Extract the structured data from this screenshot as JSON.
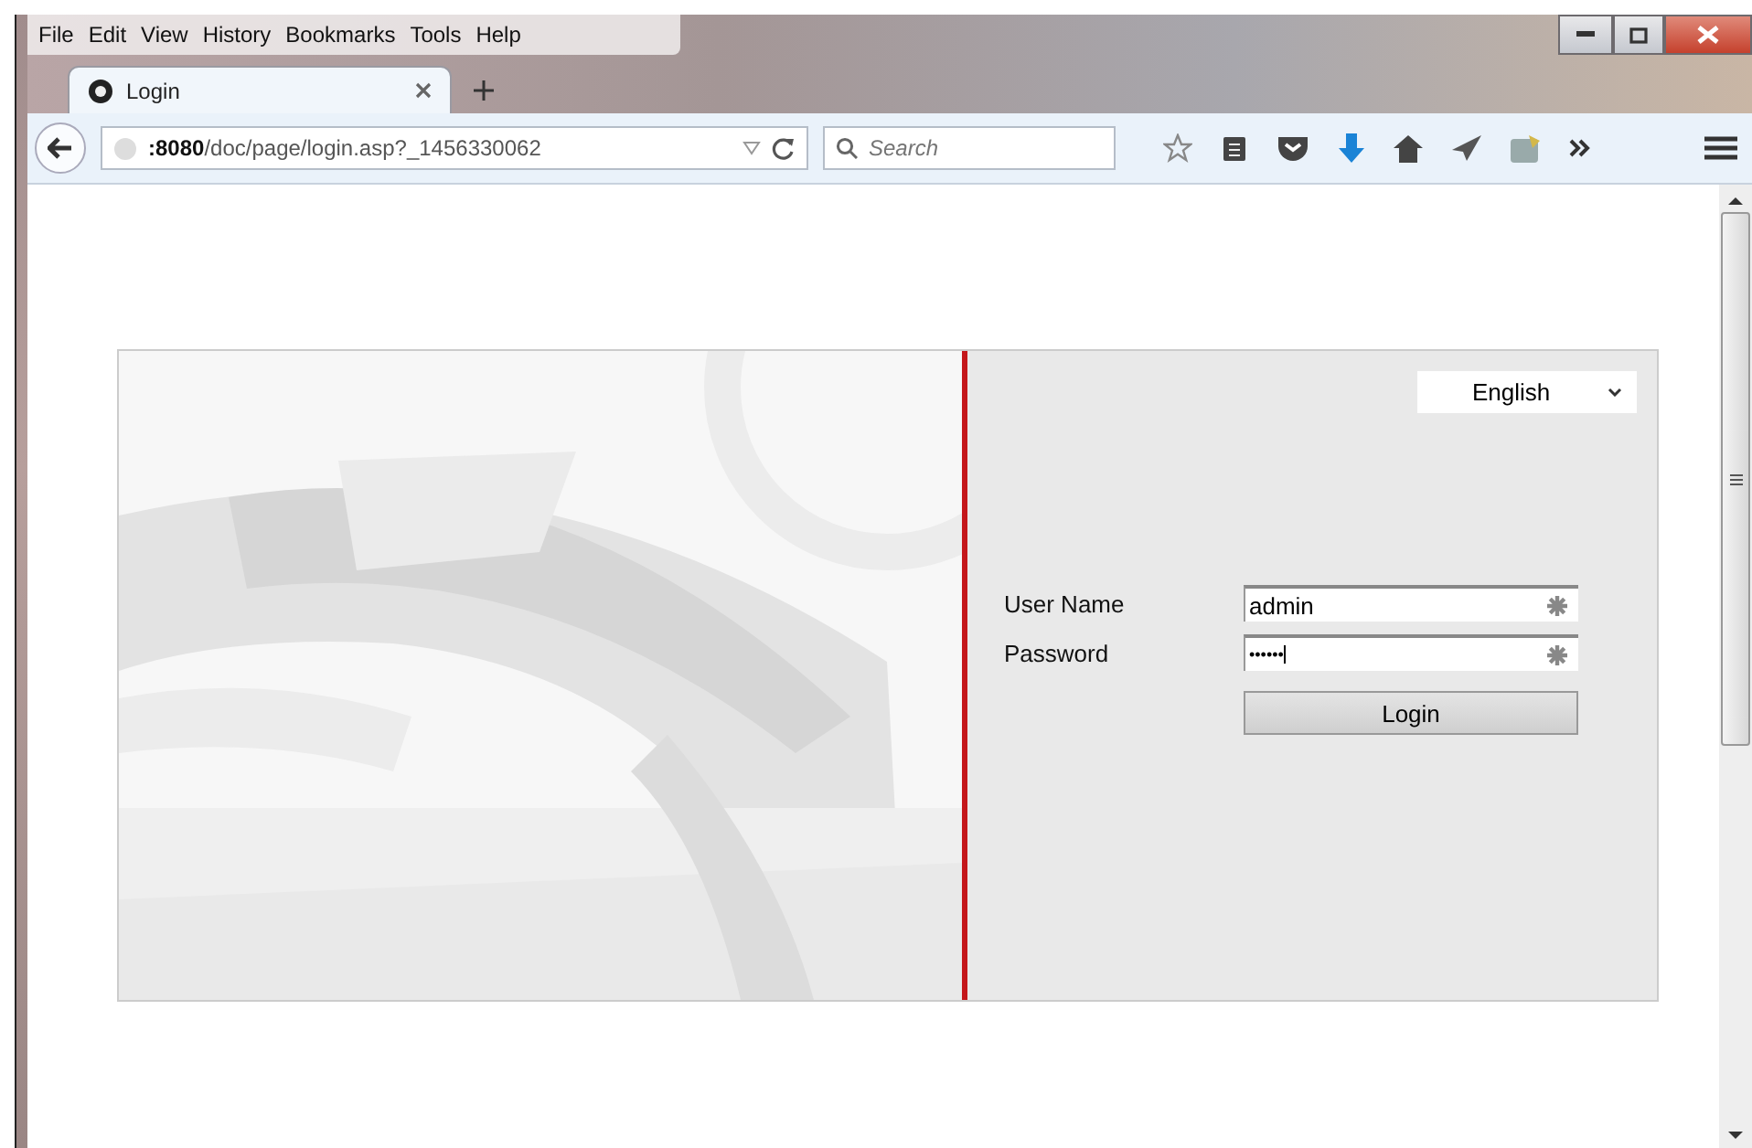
{
  "menu_bar": {
    "items": [
      "File",
      "Edit",
      "View",
      "History",
      "Bookmarks",
      "Tools",
      "Help"
    ]
  },
  "tabs": [
    {
      "title": "Login",
      "selected": true
    }
  ],
  "nav_bar": {
    "address": "**:8080**/doc/page/login.asp?_1456330062",
    "search": {
      "placeholder": "Search"
    }
  },
  "login": {
    "language": "English",
    "fields": [
      {
        "label": "User Name",
        "value": "admin",
        "kind": "text"
      },
      {
        "label": "Password",
        "value": "••••••",
        "kind": "password"
      }
    ],
    "button": "Login"
  }
}
